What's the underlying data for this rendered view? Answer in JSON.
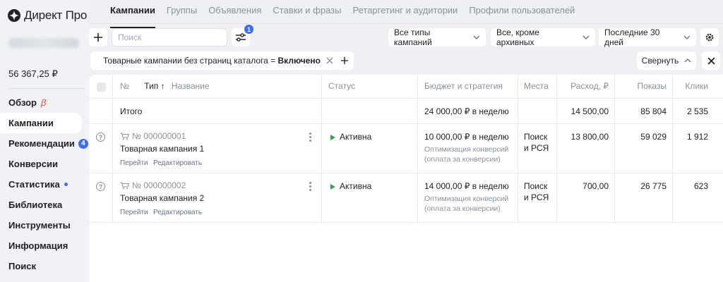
{
  "app": {
    "logo_text": "Директ Про"
  },
  "sidebar": {
    "balance": "56 367,25 ₽",
    "items": [
      {
        "label": "Обзор",
        "beta": "β"
      },
      {
        "label": "Кампании"
      },
      {
        "label": "Рекомендации",
        "badge": "4"
      },
      {
        "label": "Конверсии"
      },
      {
        "label": "Статистика"
      },
      {
        "label": "Библиотека"
      },
      {
        "label": "Инструменты"
      },
      {
        "label": "Информация"
      },
      {
        "label": "Поиск"
      }
    ]
  },
  "tabs": [
    "Кампании",
    "Группы",
    "Объявления",
    "Ставки и фразы",
    "Ретаргетинг и аудитории",
    "Профили пользователей"
  ],
  "toolbar": {
    "search_placeholder": "Поиск",
    "filter_badge": "1",
    "select_type": "Все типы кампаний",
    "select_archive": "Все, кроме архивных",
    "select_period": "Последние 30 дней"
  },
  "filter_chip": {
    "text": "Товарные кампании без страниц каталога = ",
    "value": "Включено"
  },
  "collapse_label": "Свернуть",
  "table": {
    "headers": {
      "num": "№",
      "type": "Тип",
      "sort_arrow": "↑",
      "name": "Название",
      "status": "Статус",
      "budget": "Бюджет и стратегия",
      "places": "Места",
      "expense": "Расход, ₽",
      "impressions": "Показы",
      "clicks": "Клики"
    },
    "total": {
      "label": "Итого",
      "budget": "24 000,00 ₽ в неделю",
      "expense": "14 500,00",
      "impressions": "85 804",
      "clicks": "2 535"
    },
    "rows": [
      {
        "number": "№ 000000001",
        "name": "Товарная кампания 1",
        "link_go": "Перейти",
        "link_edit": "Редактировать",
        "status": "Активна",
        "budget": "10 000,00 ₽ в неделю",
        "strategy_line1": "Оптимизация конверсий",
        "strategy_line2": "(оплата за конверсии)",
        "places_line1": "Поиск",
        "places_line2": "и РСЯ",
        "expense": "13 800,00",
        "impressions": "59 029",
        "clicks": "1 912"
      },
      {
        "number": "№ 000000002",
        "name": "Товарная кампания 2",
        "link_go": "Перейти",
        "link_edit": "Редактировать",
        "status": "Активна",
        "budget": "14 000,00 ₽ в неделю",
        "strategy_line1": "Оптимизация конверсий",
        "strategy_line2": "(оплата за конверсии)",
        "places_line1": "Поиск",
        "places_line2": "и РСЯ",
        "expense": "700,00",
        "impressions": "26 775",
        "clicks": "623"
      }
    ]
  },
  "colors": {
    "accent": "#3d6df2",
    "active_status": "#3b9e57",
    "beta": "#f5424a"
  }
}
